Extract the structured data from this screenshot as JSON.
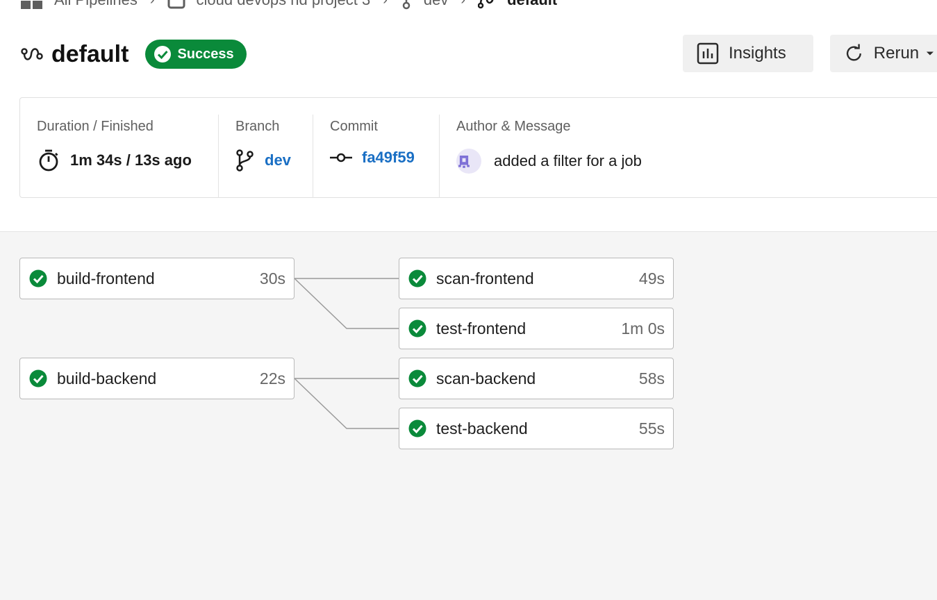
{
  "breadcrumb": {
    "items": [
      "All Pipelines",
      "cloud devops nd project 3",
      "dev",
      "default"
    ]
  },
  "header": {
    "title": "default",
    "status": "Success",
    "insights_label": "Insights",
    "rerun_label": "Rerun"
  },
  "info": {
    "duration_label": "Duration / Finished",
    "duration_value": "1m 34s / 13s ago",
    "branch_label": "Branch",
    "branch_value": "dev",
    "commit_label": "Commit",
    "commit_value": "fa49f59",
    "author_label": "Author & Message",
    "message": "added a filter for a job"
  },
  "jobs": [
    {
      "name": "build-frontend",
      "duration": "30s",
      "status": "success"
    },
    {
      "name": "scan-frontend",
      "duration": "49s",
      "status": "success"
    },
    {
      "name": "test-frontend",
      "duration": "1m 0s",
      "status": "success"
    },
    {
      "name": "build-backend",
      "duration": "22s",
      "status": "success"
    },
    {
      "name": "scan-backend",
      "duration": "58s",
      "status": "success"
    },
    {
      "name": "test-backend",
      "duration": "55s",
      "status": "success"
    }
  ],
  "colors": {
    "success": "#0a8a3a",
    "link": "#1a6fc4",
    "graph_bg": "#f5f5f5"
  }
}
